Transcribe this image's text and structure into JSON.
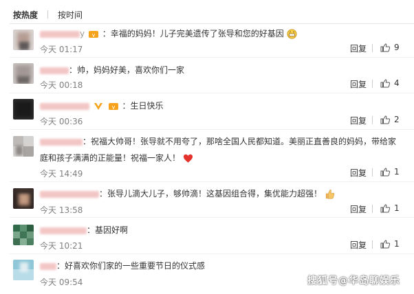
{
  "sort": {
    "hot": "按热度",
    "time": "按时间"
  },
  "reply_label": "回复",
  "comments": [
    {
      "text": "：幸福的妈妈！儿子完美遗传了张导和您的好基因",
      "time": "今天 01:17",
      "likes": "9"
    },
    {
      "text": "：帅，妈妈好美，喜欢你们一家",
      "time": "今天 00:18",
      "likes": "4"
    },
    {
      "text": "：生日快乐",
      "time": "今天 00:36",
      "likes": "2"
    },
    {
      "text": "：祝福大帅哥！张导就不用夸了，那啥全国人民都知道。美丽正直善良的妈妈，带给家",
      "text2": "庭和孩子满满的正能量！祝福一家人！",
      "time": "今天 14:49",
      "likes": "1"
    },
    {
      "text": "：张导儿滴大儿子，够帅滴！这基因组合得，集优能力超强！",
      "time": "今天 13:58",
      "likes": "1"
    },
    {
      "text": "：基因好啊",
      "time": "今天 10:21",
      "likes": "1"
    },
    {
      "text": "：好喜欢你们家的一些重要节日的仪式感",
      "time": "今天 09:54",
      "likes": ""
    }
  ],
  "icons": {
    "like": "thumbs-up-icon",
    "grin": "grin-emoji-icon",
    "heart": "heart-emoji-icon",
    "thumb_emoji": "thumbs-up-emoji-icon"
  },
  "watermark": "搜狐号@华岛聊娱乐"
}
